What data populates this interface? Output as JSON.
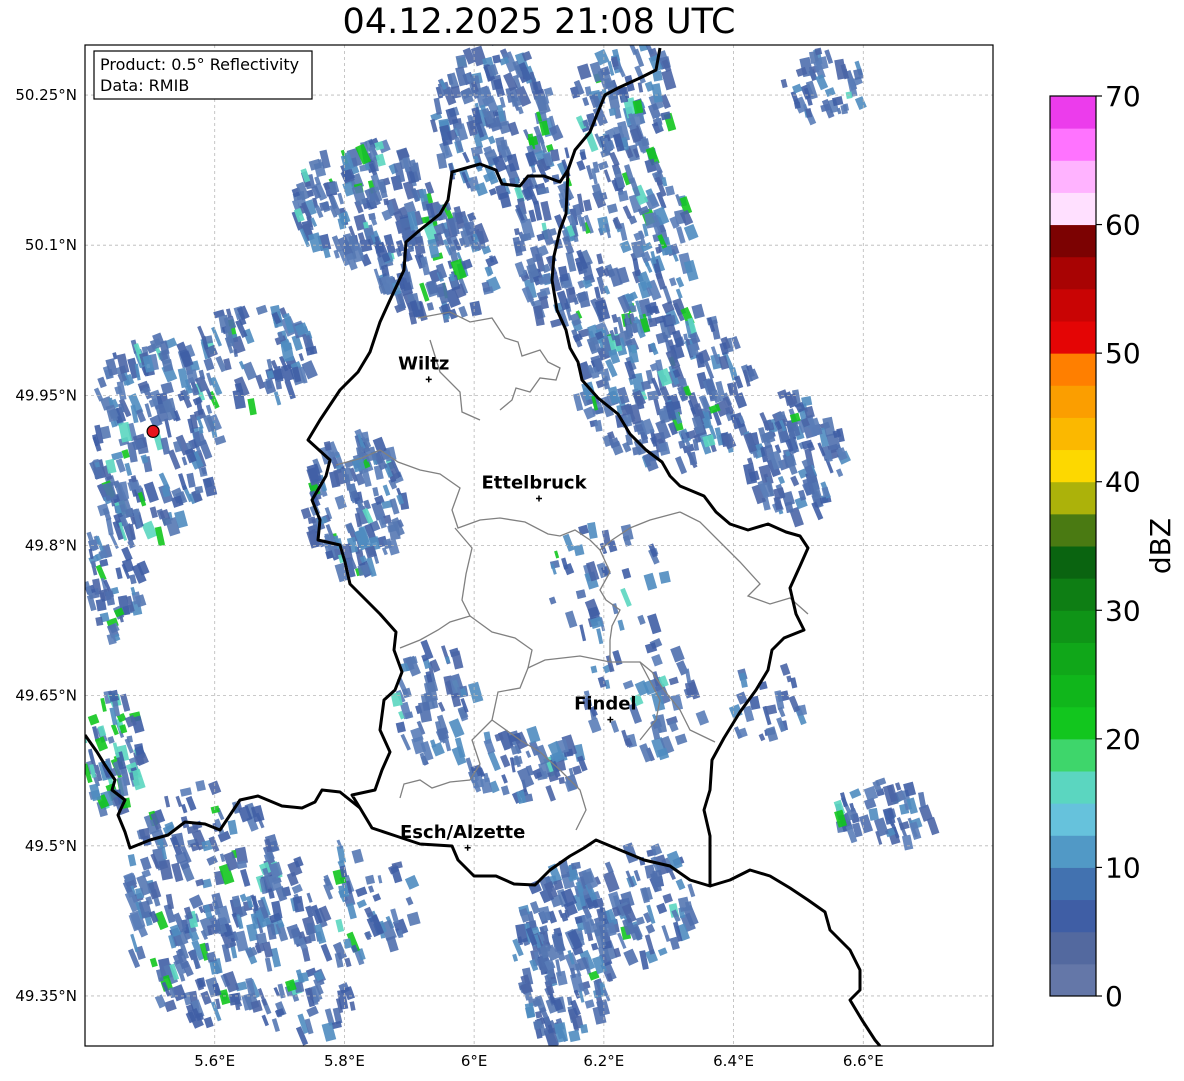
{
  "title": "04.12.2025 21:08 UTC",
  "info": {
    "product": "Product: 0.5° Reflectivity",
    "data": "Data: RMIB"
  },
  "map": {
    "lon_range": [
      5.4,
      6.8
    ],
    "lat_range": [
      49.3,
      50.3
    ],
    "lon_ticks": [
      {
        "value": 5.6,
        "label": "5.6°E"
      },
      {
        "value": 5.8,
        "label": "5.8°E"
      },
      {
        "value": 6.0,
        "label": "6°E"
      },
      {
        "value": 6.2,
        "label": "6.2°E"
      },
      {
        "value": 6.4,
        "label": "6.4°E"
      },
      {
        "value": 6.6,
        "label": "6.6°E"
      }
    ],
    "lat_ticks": [
      {
        "value": 50.25,
        "label": "50.25°N"
      },
      {
        "value": 50.1,
        "label": "50.1°N"
      },
      {
        "value": 49.95,
        "label": "49.95°N"
      },
      {
        "value": 49.8,
        "label": "49.8°N"
      },
      {
        "value": 49.65,
        "label": "49.65°N"
      },
      {
        "value": 49.5,
        "label": "49.5°N"
      },
      {
        "value": 49.35,
        "label": "49.35°N"
      }
    ],
    "gridlines": true,
    "cities": [
      {
        "name": "Wiltz",
        "lon": 5.93,
        "lat": 49.966
      },
      {
        "name": "Ettelbruck",
        "lon": 6.1,
        "lat": 49.847
      },
      {
        "name": "Findel",
        "lon": 6.21,
        "lat": 49.626
      },
      {
        "name": "Esch/Alzette",
        "lon": 5.99,
        "lat": 49.498
      }
    ],
    "radar_site": {
      "lon": 5.505,
      "lat": 49.914,
      "marker_color": "#e8141b"
    },
    "border_color": "#000000",
    "canton_border_color": "#808080"
  },
  "colorbar": {
    "label": "dBZ",
    "min": 0,
    "max": 70,
    "tick_labels": [
      "0",
      "10",
      "20",
      "30",
      "40",
      "50",
      "60",
      "70"
    ],
    "colors": [
      "#6477a8",
      "#53699f",
      "#3f5ea5",
      "#4272b0",
      "#5199c6",
      "#66c2dc",
      "#5bd6c0",
      "#3ed66b",
      "#12c61e",
      "#10b61b",
      "#10a719",
      "#0f9417",
      "#0e7e14",
      "#0a6410",
      "#4a7a12",
      "#acb20a",
      "#fdd800",
      "#fbb800",
      "#fb9e00",
      "#ff7f00",
      "#e40505",
      "#c90404",
      "#a80303",
      "#7c0202",
      "#ffe0ff",
      "#ffb3ff",
      "#ff73ff",
      "#ec3cec"
    ]
  }
}
